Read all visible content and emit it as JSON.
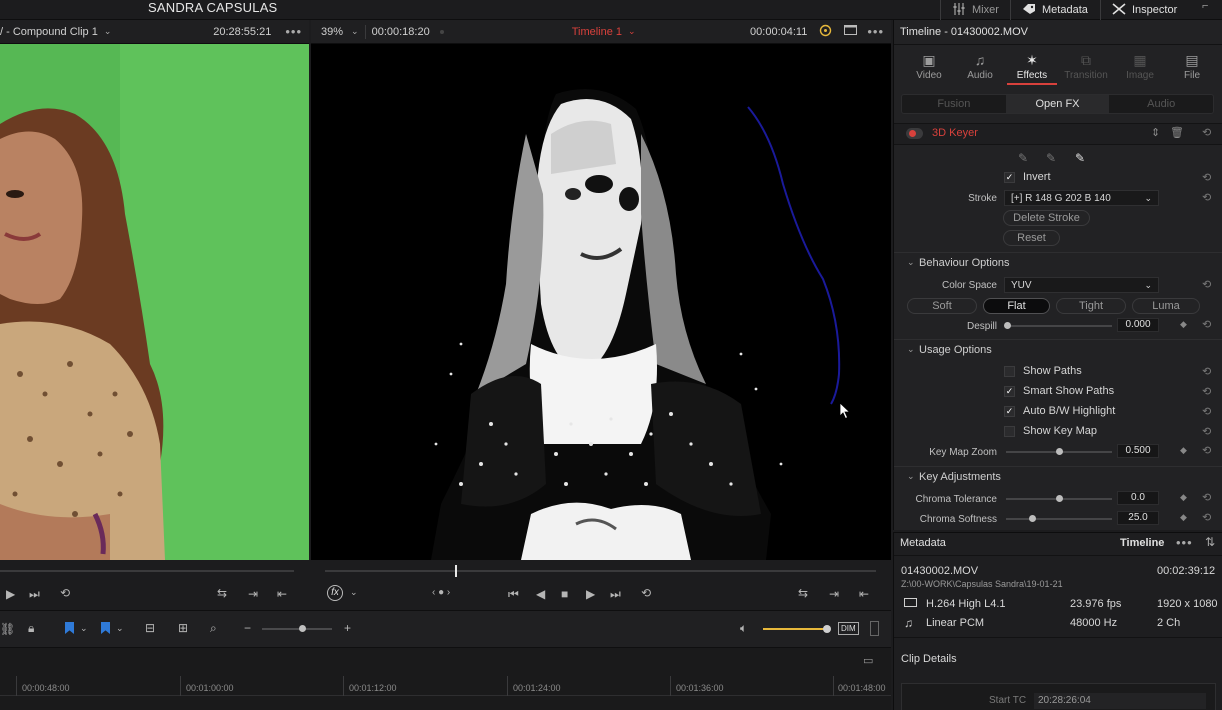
{
  "app": {
    "title": "SANDRA CAPSULAS",
    "top_buttons": {
      "mixer": "Mixer",
      "metadata": "Metadata",
      "inspector": "Inspector"
    }
  },
  "source_viewer": {
    "clip_name": "/ - Compound Clip 1",
    "timecode": "20:28:55:21"
  },
  "timeline_viewer": {
    "zoom": "39%",
    "duration": "00:00:18:20",
    "timeline_name": "Timeline 1",
    "timecode": "00:00:04:11"
  },
  "timeline_ruler": {
    "marks": [
      "00:00:48:00",
      "00:01:00:00",
      "00:01:12:00",
      "00:01:24:00",
      "00:01:36:00",
      "00:01:48:00"
    ]
  },
  "toolbar": {
    "dim_label": "DIM"
  },
  "inspector": {
    "title": "Timeline - 01430002.MOV",
    "tabs": [
      {
        "label": "Video",
        "icon": "film-icon"
      },
      {
        "label": "Audio",
        "icon": "music-note-icon"
      },
      {
        "label": "Effects",
        "icon": "magic-wand-icon"
      },
      {
        "label": "Transition",
        "icon": "transition-icon"
      },
      {
        "label": "Image",
        "icon": "image-icon"
      },
      {
        "label": "File",
        "icon": "file-icon"
      }
    ],
    "subtabs": [
      "Fusion",
      "Open FX",
      "Audio"
    ],
    "effect": {
      "name": "3D Keyer",
      "invert_label": "Invert",
      "stroke_label": "Stroke",
      "stroke_value": "[+]  R 148   G 202   B 140",
      "delete_stroke": "Delete Stroke",
      "reset": "Reset"
    },
    "behaviour": {
      "header": "Behaviour Options",
      "color_space_label": "Color Space",
      "color_space_value": "YUV",
      "modes": [
        "Soft",
        "Flat",
        "Tight",
        "Luma"
      ],
      "selected_mode": "Flat",
      "despill_label": "Despill",
      "despill_value": "0.000"
    },
    "usage": {
      "header": "Usage Options",
      "options": [
        {
          "label": "Show Paths",
          "checked": false
        },
        {
          "label": "Smart Show Paths",
          "checked": true
        },
        {
          "label": "Auto B/W Highlight",
          "checked": true
        },
        {
          "label": "Show Key Map",
          "checked": false
        }
      ],
      "key_map_zoom_label": "Key Map Zoom",
      "key_map_zoom_value": "0.500"
    },
    "key_adjustments": {
      "header": "Key Adjustments",
      "chroma_tolerance_label": "Chroma Tolerance",
      "chroma_tolerance_value": "0.0",
      "chroma_softness_label": "Chroma Softness",
      "chroma_softness_value": "25.0"
    }
  },
  "metadata": {
    "title": "Metadata",
    "scope": "Timeline",
    "clip_name": "01430002.MOV",
    "duration": "00:02:39:12",
    "path": "Z:\\00-WORK\\Capsulas Sandra\\19-01-21",
    "video_codec": "H.264 High L4.1",
    "fps": "23.976 fps",
    "resolution": "1920 x 1080",
    "audio_codec": "Linear PCM",
    "sample_rate": "48000 Hz",
    "channels": "2 Ch",
    "clip_details_label": "Clip Details",
    "start_tc_label": "Start TC",
    "start_tc_value": "20:28:26:04"
  },
  "colors": {
    "accent_red": "#d8413c",
    "green_screen": "#5fc25b",
    "volume_yellow": "#e7b83b",
    "stroke_path_blue": "#1a1a9a"
  }
}
